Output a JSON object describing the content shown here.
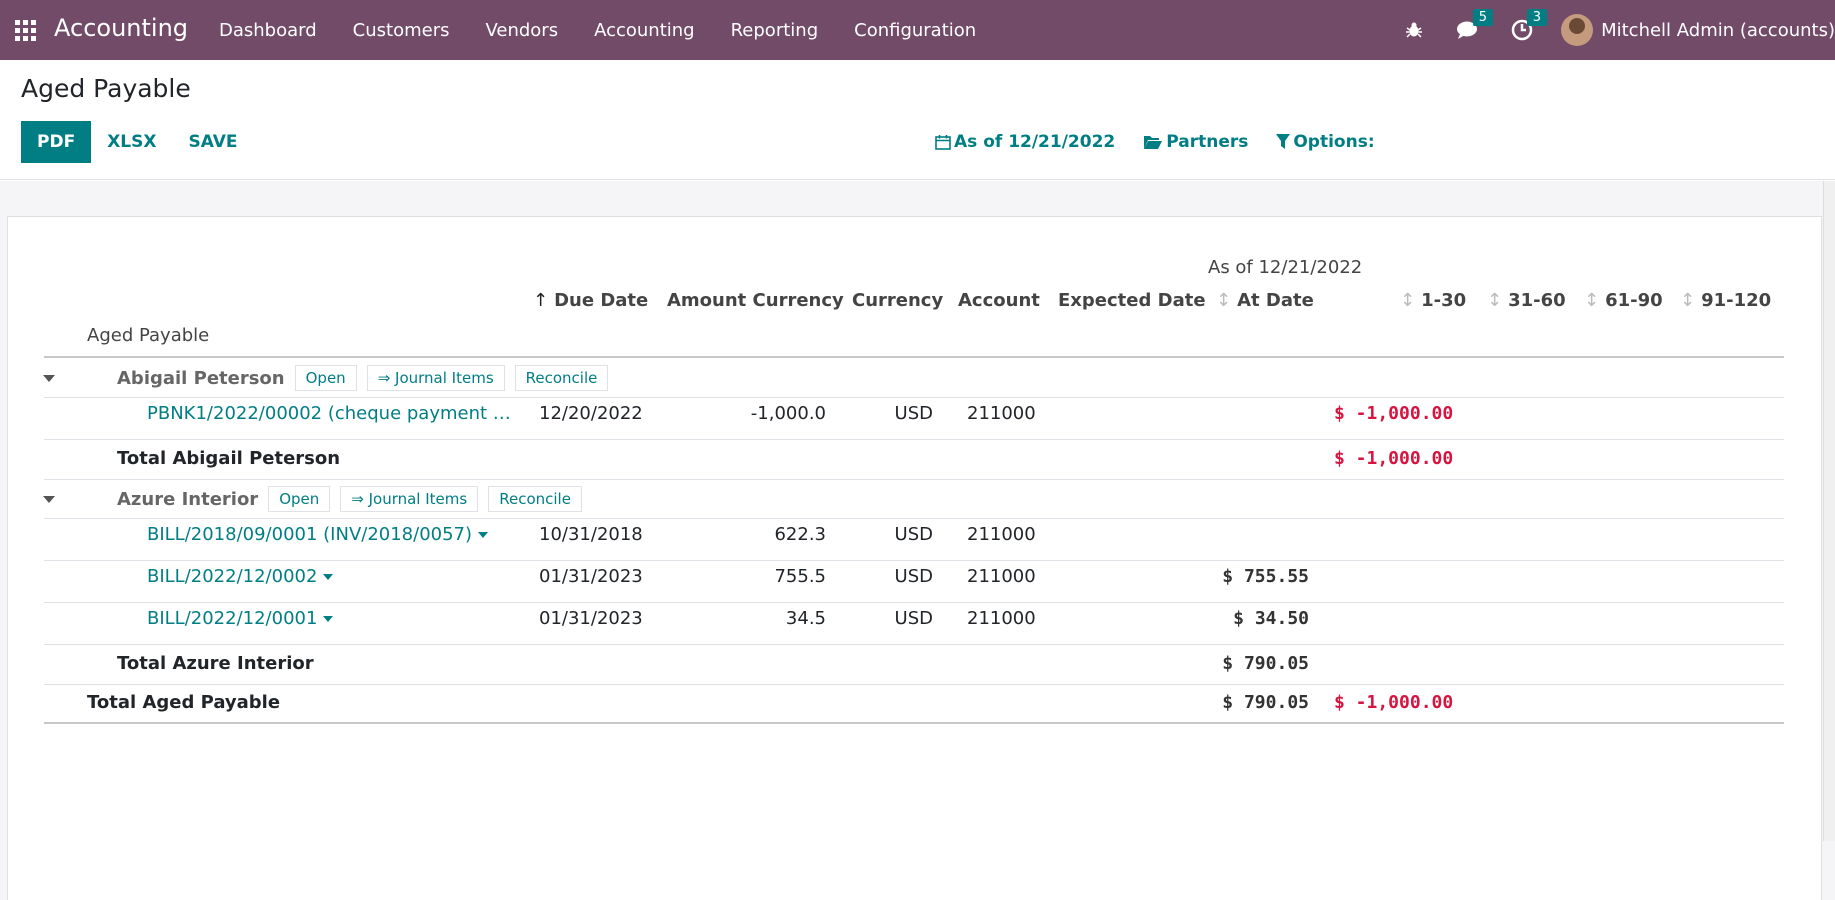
{
  "navbar": {
    "app_name": "Accounting",
    "menu": [
      "Dashboard",
      "Customers",
      "Vendors",
      "Accounting",
      "Reporting",
      "Configuration"
    ],
    "messages_count": "5",
    "activities_count": "3",
    "user": "Mitchell Admin (accounts)"
  },
  "control": {
    "title": "Aged Payable",
    "buttons": {
      "pdf": "PDF",
      "xlsx": "XLSX",
      "save": "SAVE"
    },
    "filters": {
      "date": "As of 12/21/2022",
      "partners": "Partners",
      "options": "Options:"
    }
  },
  "report": {
    "period_header": "As of 12/21/2022",
    "columns": {
      "name": "Aged Payable",
      "due_date": "Due Date",
      "amount_currency": "Amount Currency",
      "currency": "Currency",
      "account": "Account",
      "expected_date": "Expected Date",
      "at_date": "At Date",
      "c1_30": "1-30",
      "c31_60": "31-60",
      "c61_90": "61-90",
      "c91_120": "91-120"
    },
    "partner_actions": {
      "open": "Open",
      "journal_items": "⇒ Journal Items",
      "reconcile": "Reconcile"
    },
    "partners": [
      {
        "name": "Abigail Peterson",
        "lines": [
          {
            "ref": "PBNK1/2022/00002 (cheque payment …",
            "due_date": "12/20/2022",
            "amount_currency": "-1,000.0",
            "currency": "USD",
            "account": "211000",
            "at_date": "",
            "c1_30": "$ -1,000.00"
          }
        ],
        "total_label": "Total Abigail Peterson",
        "total_at_date": "",
        "total_1_30": "$ -1,000.00"
      },
      {
        "name": "Azure Interior",
        "lines": [
          {
            "ref": "BILL/2018/09/0001 (INV/2018/0057)",
            "due_date": "10/31/2018",
            "amount_currency": "622.3",
            "currency": "USD",
            "account": "211000",
            "at_date": "",
            "c1_30": ""
          },
          {
            "ref": "BILL/2022/12/0002",
            "due_date": "01/31/2023",
            "amount_currency": "755.5",
            "currency": "USD",
            "account": "211000",
            "at_date": "$ 755.55",
            "c1_30": ""
          },
          {
            "ref": "BILL/2022/12/0001",
            "due_date": "01/31/2023",
            "amount_currency": "34.5",
            "currency": "USD",
            "account": "211000",
            "at_date": "$ 34.50",
            "c1_30": ""
          }
        ],
        "total_label": "Total Azure Interior",
        "total_at_date": "$ 790.05",
        "total_1_30": ""
      }
    ],
    "grand_total": {
      "label": "Total Aged Payable",
      "at_date": "$ 790.05",
      "c1_30": "$ -1,000.00"
    }
  },
  "colors": {
    "navbar": "#714b67",
    "accent": "#017e84",
    "negative": "#d6143f"
  }
}
